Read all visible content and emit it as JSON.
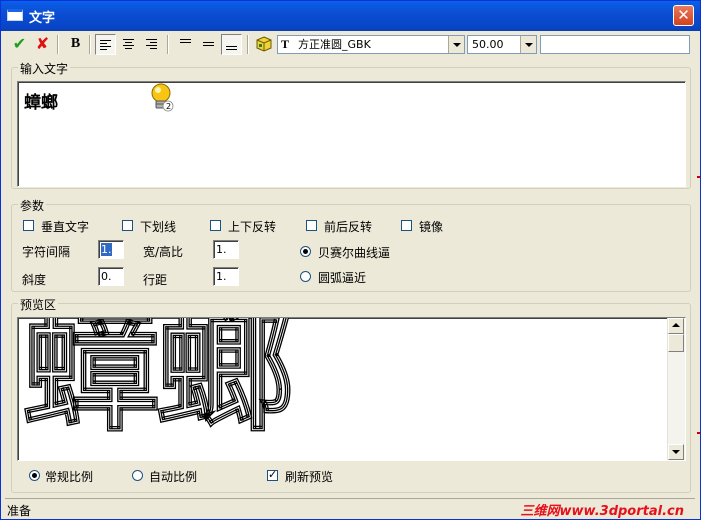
{
  "window": {
    "title": "文字",
    "close": "✕"
  },
  "toolbar": {
    "ok_glyph": "✔",
    "cancel_glyph": "✘",
    "bold_label": "B",
    "font_icon": "T",
    "font_value": "方正准圆_GBK",
    "size_value": "50.00",
    "extra_value": ""
  },
  "input_group": {
    "label": "输入文字",
    "text": "蟑螂"
  },
  "params": {
    "label": "参数",
    "vertical_text": "垂直文字",
    "underline": "下划线",
    "flip_vertical": "上下反转",
    "flip_horizontal": "前后反转",
    "mirror": "镜像",
    "char_spacing_label": "字符间隔",
    "char_spacing_value": "1.",
    "aspect_label": "宽/高比",
    "aspect_value": "1.",
    "bezier_label": "贝赛尔曲线逼",
    "slant_label": "斜度",
    "slant_value": "0.",
    "line_spacing_label": "行距",
    "line_spacing_value": "1.",
    "arc_label": "圆弧逼近"
  },
  "preview": {
    "label": "预览区",
    "text": "蟑螂",
    "normal_scale": "常规比例",
    "auto_scale": "自动比例",
    "refresh": "刷新预览"
  },
  "status": {
    "text": "准备",
    "watermark": "三维网www.3dportal.cn"
  },
  "colors": {
    "title_blue": "#0b4ed3",
    "ok_green": "#1e9e1e",
    "cancel_red": "#e01010",
    "watermark_red": "#e8101a"
  }
}
